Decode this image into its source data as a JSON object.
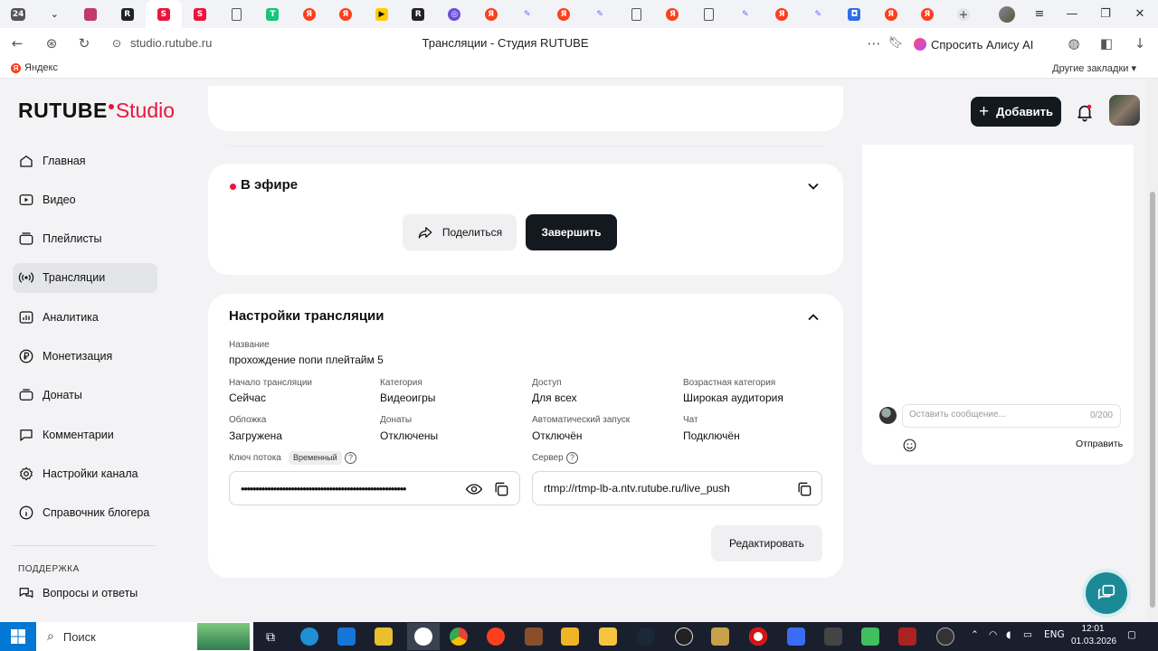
{
  "browser": {
    "tab_badge": "24",
    "url": "studio.rutube.ru",
    "page_title": "Трансляции - Студия RUTUBE",
    "alice_label": "Спросить Алису AI",
    "bookmark_yandex": "Яндекс",
    "bookmark_other": "Другие закладки"
  },
  "header": {
    "logo_main": "RUTUBE",
    "logo_studio": "Studio",
    "add_button": "Добавить"
  },
  "sidebar": {
    "items": [
      {
        "label": "Главная",
        "icon": "home-icon"
      },
      {
        "label": "Видео",
        "icon": "video-icon"
      },
      {
        "label": "Плейлисты",
        "icon": "playlist-icon"
      },
      {
        "label": "Трансляции",
        "icon": "broadcast-icon",
        "active": true
      },
      {
        "label": "Аналитика",
        "icon": "analytics-icon"
      },
      {
        "label": "Монетизация",
        "icon": "ruble-icon"
      },
      {
        "label": "Донаты",
        "icon": "donate-icon"
      },
      {
        "label": "Комментарии",
        "icon": "comment-icon"
      },
      {
        "label": "Настройки канала",
        "icon": "gear-icon"
      },
      {
        "label": "Справочник блогера",
        "icon": "book-icon"
      }
    ],
    "support_heading": "ПОДДЕРЖКА",
    "faq": "Вопросы и ответы"
  },
  "live": {
    "status": "В эфире",
    "share_button": "Поделиться",
    "end_button": "Завершить"
  },
  "settings": {
    "title": "Настройки трансляции",
    "name_label": "Название",
    "name_value": "прохождение попи плейтайм 5",
    "start_label": "Начало трансляции",
    "start_value": "Сейчас",
    "category_label": "Категория",
    "category_value": "Видеоигры",
    "access_label": "Доступ",
    "access_value": "Для всех",
    "age_label": "Возрастная категория",
    "age_value": "Широкая аудитория",
    "cover_label": "Обложка",
    "cover_value": "Загружена",
    "donations_label": "Донаты",
    "donations_value": "Отключены",
    "autostart_label": "Автоматический запуск",
    "autostart_value": "Отключён",
    "chat_label": "Чат",
    "chat_value": "Подключён",
    "key_label": "Ключ потока",
    "key_tag": "Временный",
    "key_value": "••••••••••••••••••••••••••••••••••••••••••••••••••••••••",
    "server_label": "Сервер",
    "server_value": "rtmp://rtmp-lb-a.ntv.rutube.ru/live_push",
    "edit_button": "Редактировать"
  },
  "chat": {
    "placeholder": "Оставить сообщение...",
    "counter": "0/200",
    "send": "Отправить"
  },
  "taskbar": {
    "search": "Поиск",
    "lang": "ENG",
    "time": "12:01",
    "date": "01.03.2026"
  },
  "colors": {
    "brand_red": "#ed143b",
    "dark_button": "#14191f",
    "fab_teal": "#1b8a96"
  }
}
